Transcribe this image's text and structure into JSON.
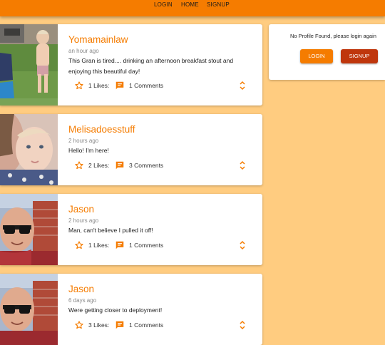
{
  "nav": {
    "login": "LOGIN",
    "home": "HOME",
    "signup": "SIGNUP"
  },
  "colors": {
    "primary": "#f57c00",
    "secondary": "#bf360c",
    "background": "#ffcc80"
  },
  "posts": [
    {
      "author": "Yomamainlaw",
      "time": "an hour ago",
      "text": "This Gran is tired.... drinking an afternoon breakfast stout and enjoying this beautiful day!",
      "likes_label": "1 Likes:",
      "comments_label": "1 Comments"
    },
    {
      "author": "Melisadoesstuff",
      "time": "2 hours ago",
      "text": "Hello! I'm here!",
      "likes_label": "2 Likes:",
      "comments_label": "3 Comments"
    },
    {
      "author": "Jason",
      "time": "2 hours ago",
      "text": "Man, can't believe I pulled it off!",
      "likes_label": "1 Likes:",
      "comments_label": "1 Comments"
    },
    {
      "author": "Jason",
      "time": "6 days ago",
      "text": "Were getting closer to deployment!",
      "likes_label": "3 Likes:",
      "comments_label": "1 Comments"
    }
  ],
  "profile": {
    "message": "No Profile Found, please login again",
    "login_label": "LOGIN",
    "signup_label": "SIGNUP"
  },
  "icons": {
    "like": "star-outline-icon",
    "comment": "comment-icon",
    "expand": "unfold-more-icon"
  }
}
